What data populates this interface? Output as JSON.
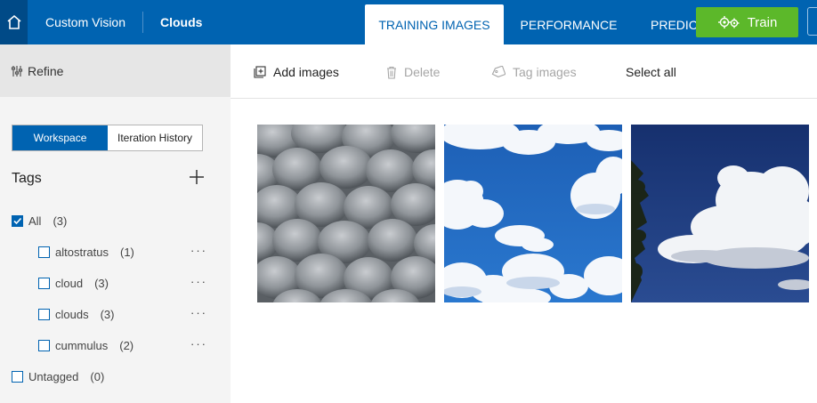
{
  "header": {
    "product": "Custom Vision",
    "project": "Clouds",
    "tabs": [
      {
        "label": "TRAINING IMAGES",
        "active": true
      },
      {
        "label": "PERFORMANCE",
        "active": false
      },
      {
        "label": "PREDICT",
        "active": false
      }
    ],
    "train_label": "Train",
    "colors": {
      "brand": "#0063b1",
      "train": "#5cb82a"
    }
  },
  "sidebar": {
    "refine_label": "Refine",
    "segments": {
      "workspace": "Workspace",
      "history": "Iteration History"
    },
    "tags_title": "Tags",
    "all": {
      "label": "All",
      "count": "(3)",
      "checked": true
    },
    "tags": [
      {
        "label": "altostratus",
        "count": "(1)"
      },
      {
        "label": "cloud",
        "count": "(3)"
      },
      {
        "label": "clouds",
        "count": "(3)"
      },
      {
        "label": "cummulus",
        "count": "(2)"
      }
    ],
    "more_label": "···",
    "untagged": {
      "label": "Untagged",
      "count": "(0)"
    }
  },
  "toolbar": {
    "add_images": "Add images",
    "delete": "Delete",
    "tag_images": "Tag images",
    "select_all": "Select all"
  },
  "images": [
    {
      "name": "mammatus-clouds-image"
    },
    {
      "name": "blue-sky-cumulus-image"
    },
    {
      "name": "cumulus-over-trees-image"
    }
  ]
}
